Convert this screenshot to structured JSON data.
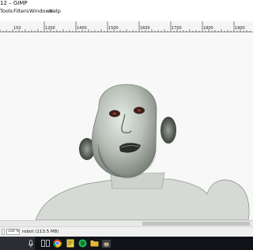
{
  "window": {
    "title": "12 – GIMP"
  },
  "menu": [
    {
      "label": "Tools"
    },
    {
      "label": "Filters"
    },
    {
      "label": "Windows"
    },
    {
      "label": "Help"
    }
  ],
  "ruler": {
    "labels": [
      "150",
      "1200",
      "1400",
      "1500",
      "1600",
      "1700",
      "1800",
      "1900"
    ]
  },
  "status": {
    "zoom": "100 %",
    "text": "robot (113.5 MB)"
  },
  "taskbar": {
    "icons": [
      "mic-icon",
      "task-view-icon",
      "chrome-icon",
      "notes-icon",
      "spotify-icon",
      "explorer-icon",
      "gimp-icon"
    ]
  },
  "colors": {
    "skin": "#c8cfc8",
    "body": "#d6dad4",
    "taskbar": "#101418",
    "spotify": "#1db954"
  }
}
